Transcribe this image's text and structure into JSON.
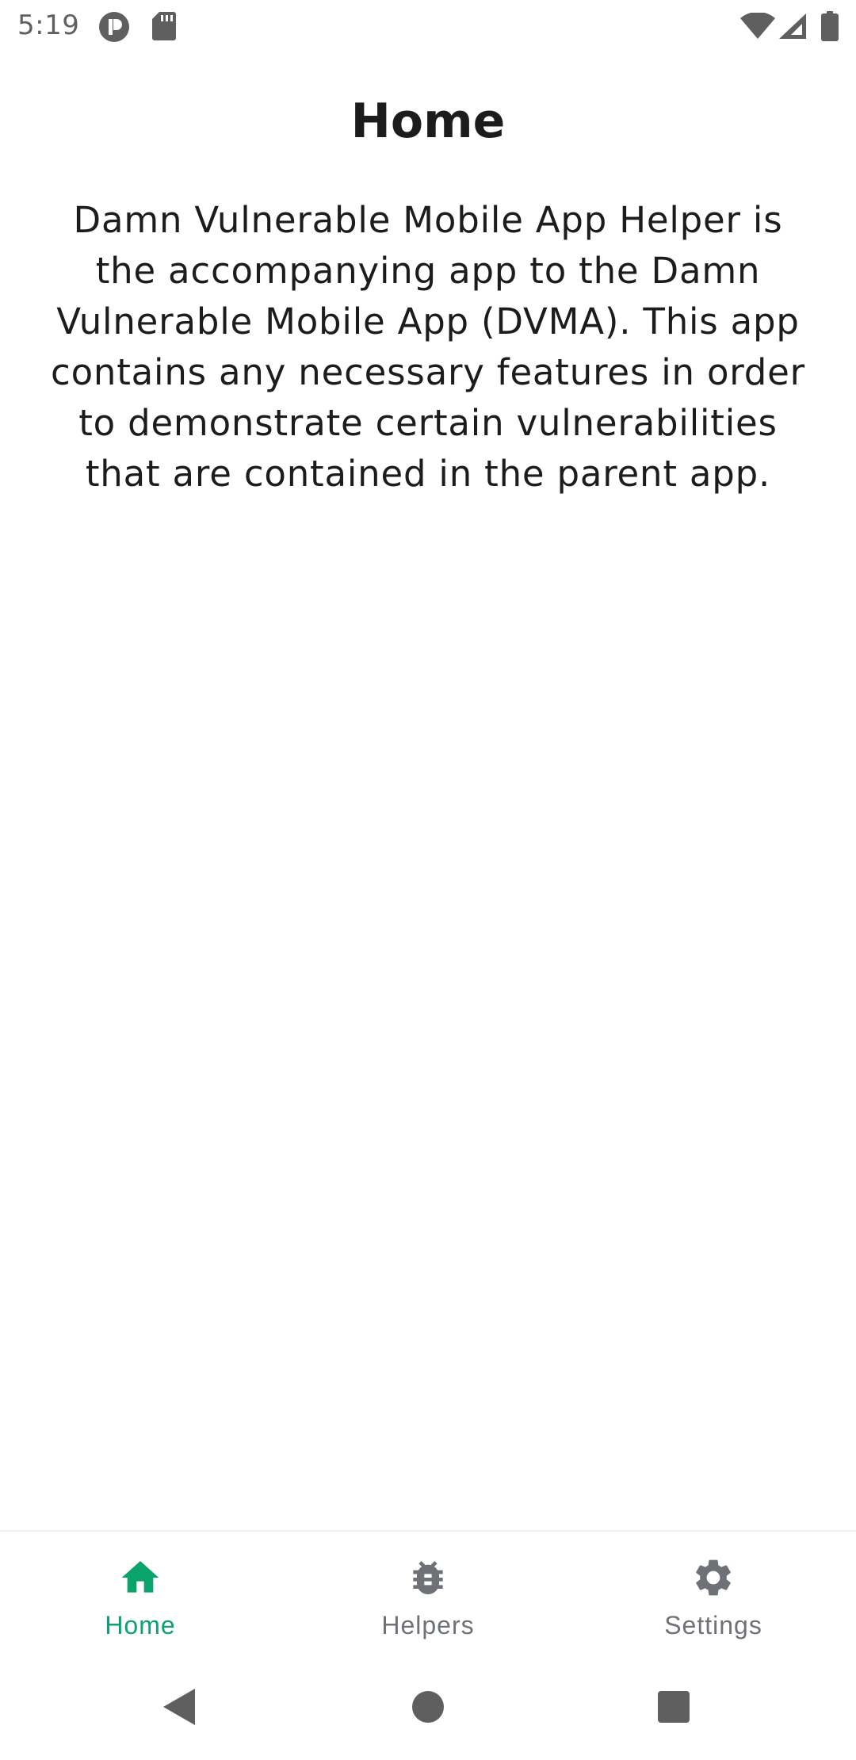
{
  "status_bar": {
    "time": "5:19",
    "icons": [
      "app-notification-icon",
      "sd-card-icon",
      "wifi-icon",
      "cell-signal-icon",
      "battery-icon"
    ]
  },
  "page": {
    "title": "Home",
    "description": "Damn Vulnerable Mobile App Helper is the accompanying app to the Damn Vulnerable Mobile App (DVMA). This app contains any necessary features in order to demonstrate certain vulnerabilities that are contained in the parent app."
  },
  "bottom_nav": {
    "selected": "Home",
    "items": [
      {
        "label": "Home",
        "icon": "home-icon"
      },
      {
        "label": "Helpers",
        "icon": "bug-icon"
      },
      {
        "label": "Settings",
        "icon": "gear-icon"
      }
    ]
  },
  "system_nav": {
    "buttons": [
      "back-icon",
      "home-circle-icon",
      "recents-icon"
    ]
  },
  "colors": {
    "accent": "#0aa36b",
    "inactive": "#6e7176",
    "text": "#1c1c1c",
    "background": "#ffffff"
  }
}
